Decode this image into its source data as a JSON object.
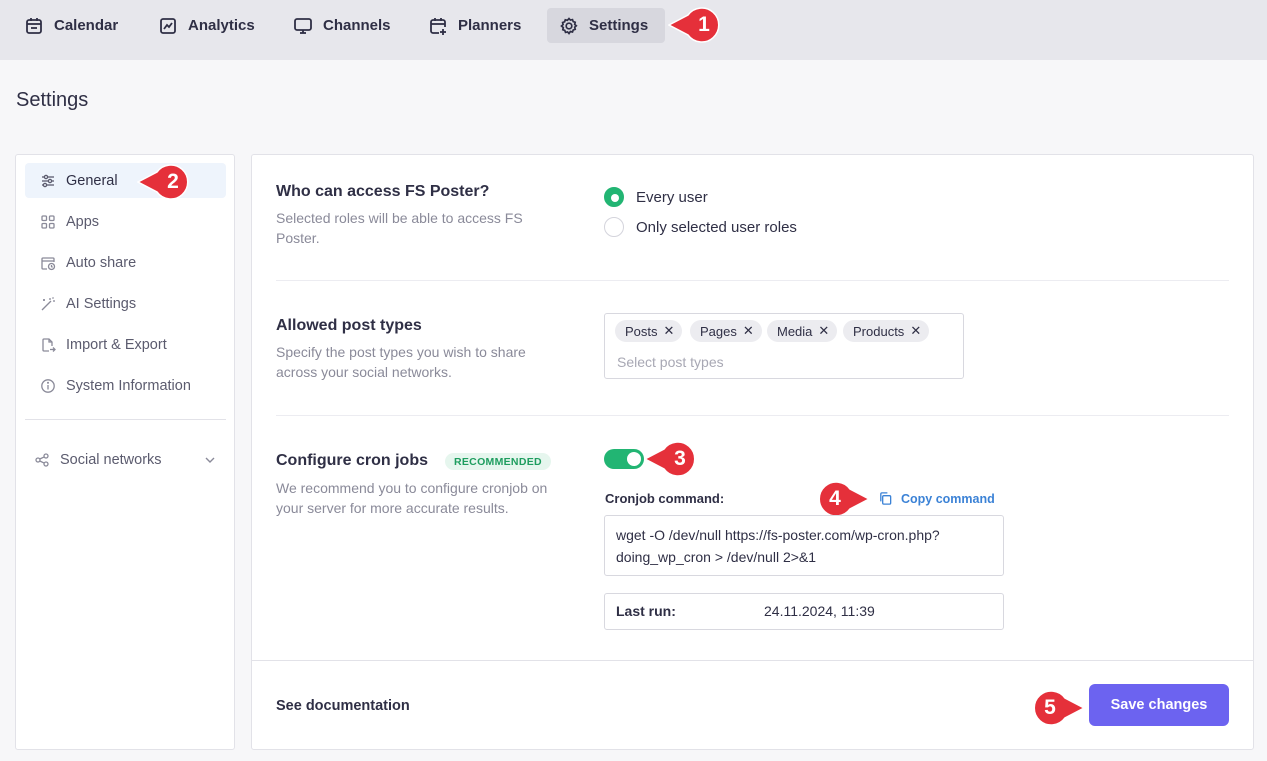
{
  "nav": {
    "items": [
      {
        "label": "Calendar",
        "icon": "calendar-icon"
      },
      {
        "label": "Analytics",
        "icon": "analytics-icon"
      },
      {
        "label": "Channels",
        "icon": "monitor-icon"
      },
      {
        "label": "Planners",
        "icon": "calendar-plus-icon"
      },
      {
        "label": "Settings",
        "icon": "gear-icon",
        "active": true
      }
    ]
  },
  "page_title": "Settings",
  "sidebar": {
    "items": [
      {
        "label": "General",
        "icon": "sliders-icon",
        "active": true
      },
      {
        "label": "Apps",
        "icon": "apps-grid-icon"
      },
      {
        "label": "Auto share",
        "icon": "calendar-clock-icon"
      },
      {
        "label": "AI Settings",
        "icon": "magic-wand-icon"
      },
      {
        "label": "Import & Export",
        "icon": "file-export-icon"
      },
      {
        "label": "System Information",
        "icon": "info-icon"
      }
    ],
    "group": {
      "label": "Social networks",
      "icon": "share-nodes-icon"
    }
  },
  "access": {
    "title": "Who can access FS Poster?",
    "description": "Selected roles will be able to access FS Poster.",
    "options": [
      {
        "label": "Every user",
        "selected": true
      },
      {
        "label": "Only selected user roles",
        "selected": false
      }
    ]
  },
  "post_types": {
    "title": "Allowed post types",
    "description": "Specify the post types you wish to share across your social networks.",
    "tags": [
      "Posts",
      "Pages",
      "Media",
      "Products"
    ],
    "placeholder": "Select post types"
  },
  "cron": {
    "title": "Configure cron jobs",
    "badge": "RECOMMENDED",
    "description": "We recommend you to configure cronjob on your server for more accurate results.",
    "enabled": true,
    "command_label": "Cronjob command:",
    "copy_label": "Copy command",
    "command": "wget -O /dev/null https://fs-poster.com/wp-cron.php?doing_wp_cron > /dev/null 2>&1",
    "last_run_label": "Last run:",
    "last_run_value": "24.11.2024, 11:39"
  },
  "footer": {
    "docs_label": "See documentation",
    "save_label": "Save changes"
  },
  "markers": [
    "1",
    "2",
    "3",
    "4",
    "5"
  ],
  "colors": {
    "accent": "#6c63f0",
    "success": "#22b573",
    "marker": "#e5303a",
    "link": "#3b82d6"
  }
}
